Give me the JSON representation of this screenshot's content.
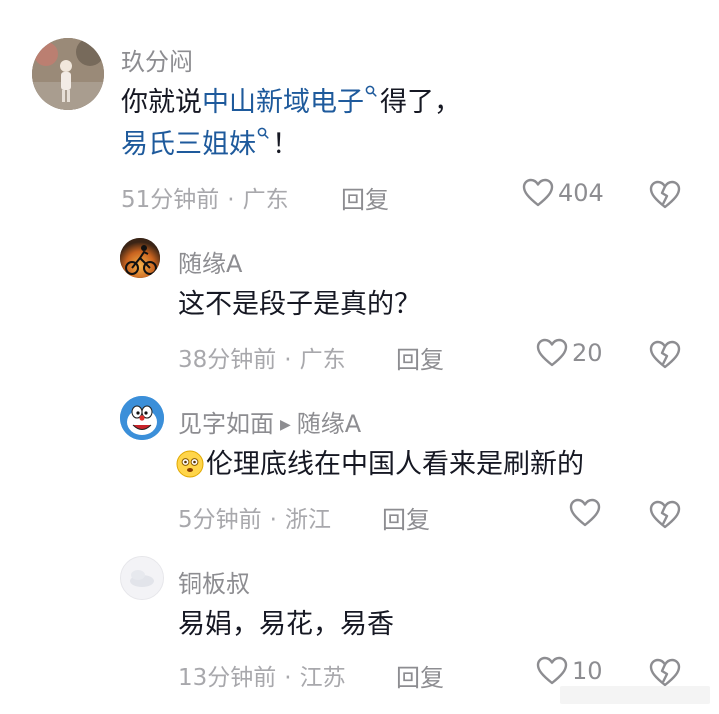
{
  "comments": [
    {
      "username": "玖分闷",
      "content_parts": [
        "你就说",
        "中山新域电子",
        "得了，",
        "易氏三姐妹",
        "！"
      ],
      "time": "51分钟前",
      "location": "广东",
      "reply_label": "回复",
      "likes": "404"
    },
    {
      "username": "随缘A",
      "content": "这不是段子是真的？",
      "time": "38分钟前",
      "location": "广东",
      "reply_label": "回复",
      "likes": "20"
    },
    {
      "username": "见字如面",
      "reply_to": "随缘A",
      "content": "伦理底线在中国人看来是刷新的",
      "time": "5分钟前",
      "location": "浙江",
      "reply_label": "回复",
      "likes": ""
    },
    {
      "username": "铜板叔",
      "content": "易娟，易花，易香",
      "time": "13分钟前",
      "location": "江苏",
      "reply_label": "回复",
      "likes": "10"
    }
  ],
  "separator": "·",
  "colors": {
    "link": "#1e5a9c",
    "text": "#161823",
    "muted": "#8d8d91"
  },
  "icons": [
    "heart-icon",
    "dislike-heart-icon",
    "search-icon",
    "emoji-icon",
    "arrow-right-icon"
  ]
}
